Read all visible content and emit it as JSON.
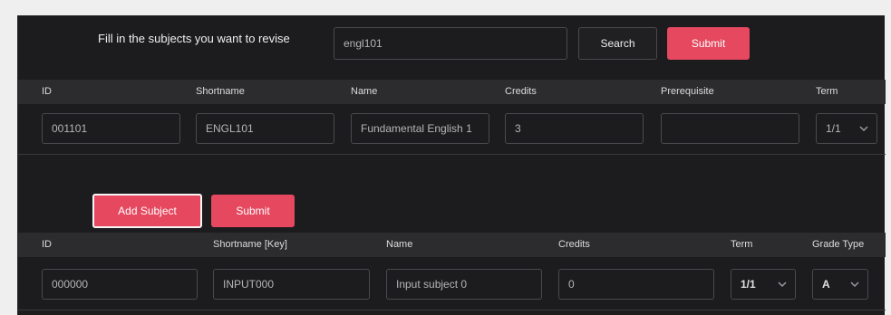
{
  "revise": {
    "prompt": "Fill in the subjects you want to revise",
    "search_value": "engl101",
    "search_label": "Search",
    "submit_label": "Submit"
  },
  "table1": {
    "headers": [
      "ID",
      "Shortname",
      "Name",
      "Credits",
      "Prerequisite",
      "Term"
    ],
    "row": {
      "id": "001101",
      "shortname": "ENGL101",
      "name": "Fundamental English 1",
      "credits": "3",
      "prerequisite": "",
      "term": "1/1"
    }
  },
  "actions": {
    "add_subject_label": "Add Subject",
    "submit_label": "Submit"
  },
  "table2": {
    "headers": [
      "ID",
      "Shortname [Key]",
      "Name",
      "Credits",
      "Term",
      "Grade Type"
    ],
    "row": {
      "id": "000000",
      "shortname": "INPUT000",
      "name": "Input subject 0",
      "credits": "0",
      "term": "1/1",
      "grade_type": "A"
    }
  },
  "icons": {
    "select_chevron": "chevron-down-icon"
  },
  "colors": {
    "accent": "#e5485f",
    "panel": "#1c1c1e",
    "header": "#2c2c2f"
  }
}
